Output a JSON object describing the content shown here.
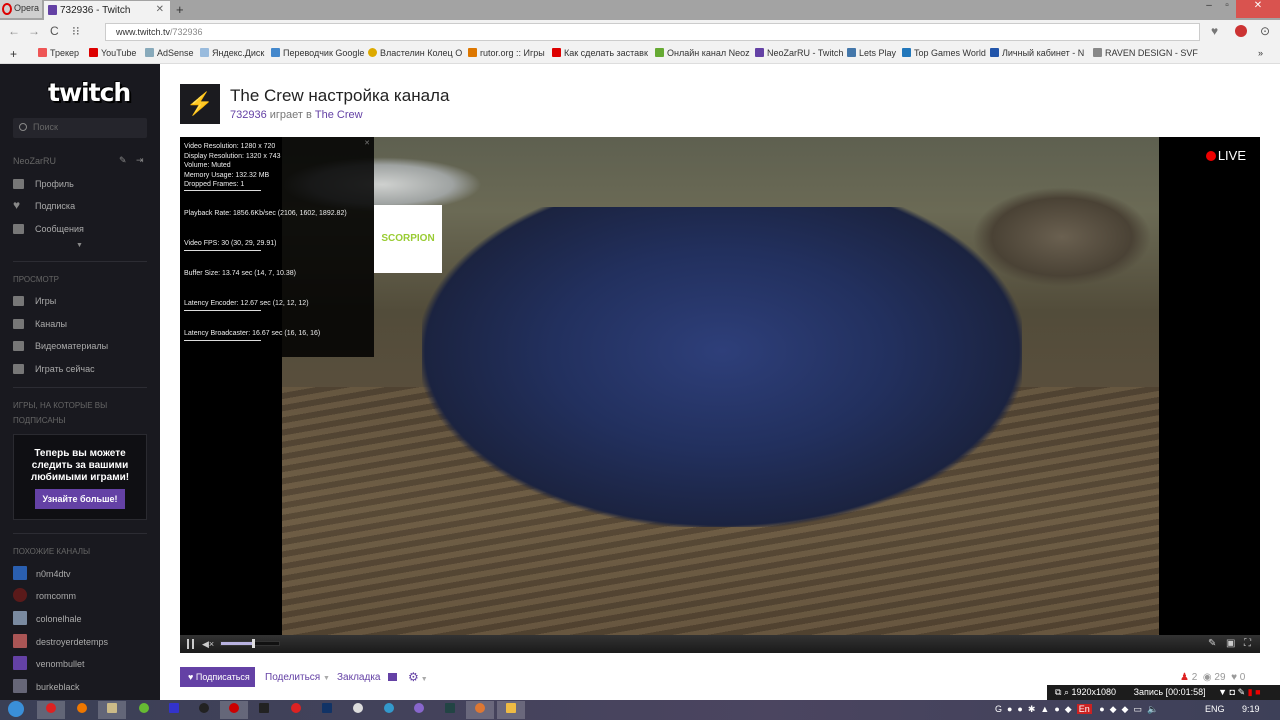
{
  "browser": {
    "opera_label": "Opera",
    "tab_title": "732936 - Twitch",
    "url_host": "www.twitch.tv",
    "url_path": "/732936",
    "bookmarks": [
      "Трекер",
      "YouTube",
      "AdSense",
      "Яндекс.Диск",
      "Переводчик Google",
      "Властелин Колец О",
      "rutor.org :: Игры",
      "Как сделать заставк",
      "Онлайн канал Neoz",
      "NeoZarRU - Twitch",
      "Lets Play",
      "Top Games World",
      "Личный кабинет - N",
      "RAVEN DESIGN - SVF"
    ],
    "more": "»"
  },
  "sidebar": {
    "logo": "twitch",
    "search_placeholder": "Поиск",
    "username": "NeoZarRU",
    "user_items": [
      "Профиль",
      "Подписка",
      "Сообщения"
    ],
    "browse_header": "ПРОСМОТР",
    "browse_items": [
      "Игры",
      "Каналы",
      "Видеоматериалы",
      "Играть сейчас"
    ],
    "games_header_1": "ИГРЫ, НА КОТОРЫЕ ВЫ",
    "games_header_2": "ПОДПИСАНЫ",
    "promo_text": "Теперь вы можете следить за вашими любимыми играми!",
    "promo_button": "Узнайте больше!",
    "similar_header": "ПОХОЖИЕ КАНАЛЫ",
    "channels": [
      "n0m4dtv",
      "romcomm",
      "colonelhale",
      "destroyerdetemps",
      "venombullet",
      "burkeblack"
    ]
  },
  "channel": {
    "title": "The Crew настройка канала",
    "user": "732936",
    "playing": " играет в ",
    "game": "The Crew"
  },
  "player": {
    "live": "LIVE",
    "volume_level": 0.55,
    "overlay_logo": "SCORPION",
    "stats": [
      "Video Resolution: 1280 x 720",
      "Display Resolution: 1320 x 743",
      "Volume: Muted",
      "Memory Usage: 132.32 MB",
      "Dropped Frames: 1",
      "Playback Rate: 1856.6Kb/sec (2106, 1602, 1892.82)",
      "Video FPS: 30 (30, 29, 29.91)",
      "Buffer Size: 13.74 sec (14, 7, 10.38)",
      "Latency Encoder: 12.67 sec (12, 12, 12)",
      "Latency Broadcaster: 16.67 sec (16, 16, 16)"
    ]
  },
  "actions": {
    "follow": "Подписаться",
    "share": "Поделиться",
    "bookmark": "Закладка"
  },
  "counts": {
    "followers": "2",
    "viewers": "29",
    "hearts": "0"
  },
  "recorder": {
    "resolution": "1920x1080",
    "status": "Запись [00:01:58]"
  },
  "tray": {
    "lang": "ENG",
    "time": "9:19",
    "lang_badge": "En"
  }
}
